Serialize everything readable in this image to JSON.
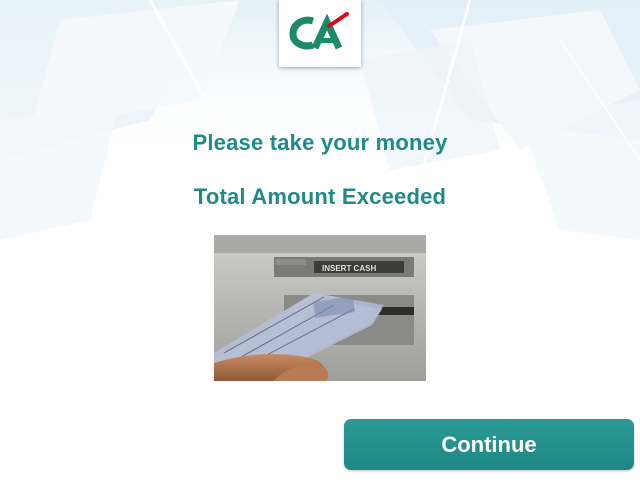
{
  "brand": {
    "logo_icon": "credit-agricole-logo-icon",
    "colors": {
      "green": "#1b8a6b",
      "red": "#e2001a"
    }
  },
  "messages": {
    "take_money": "Please take your money",
    "amount_exceeded": "Total Amount Exceeded"
  },
  "illustration": {
    "slot_label": "INSERT CASH"
  },
  "actions": {
    "continue_label": "Continue"
  },
  "theme": {
    "accent": "#1f8a87",
    "button_bg": "#23918c",
    "button_text": "#ffffff"
  }
}
